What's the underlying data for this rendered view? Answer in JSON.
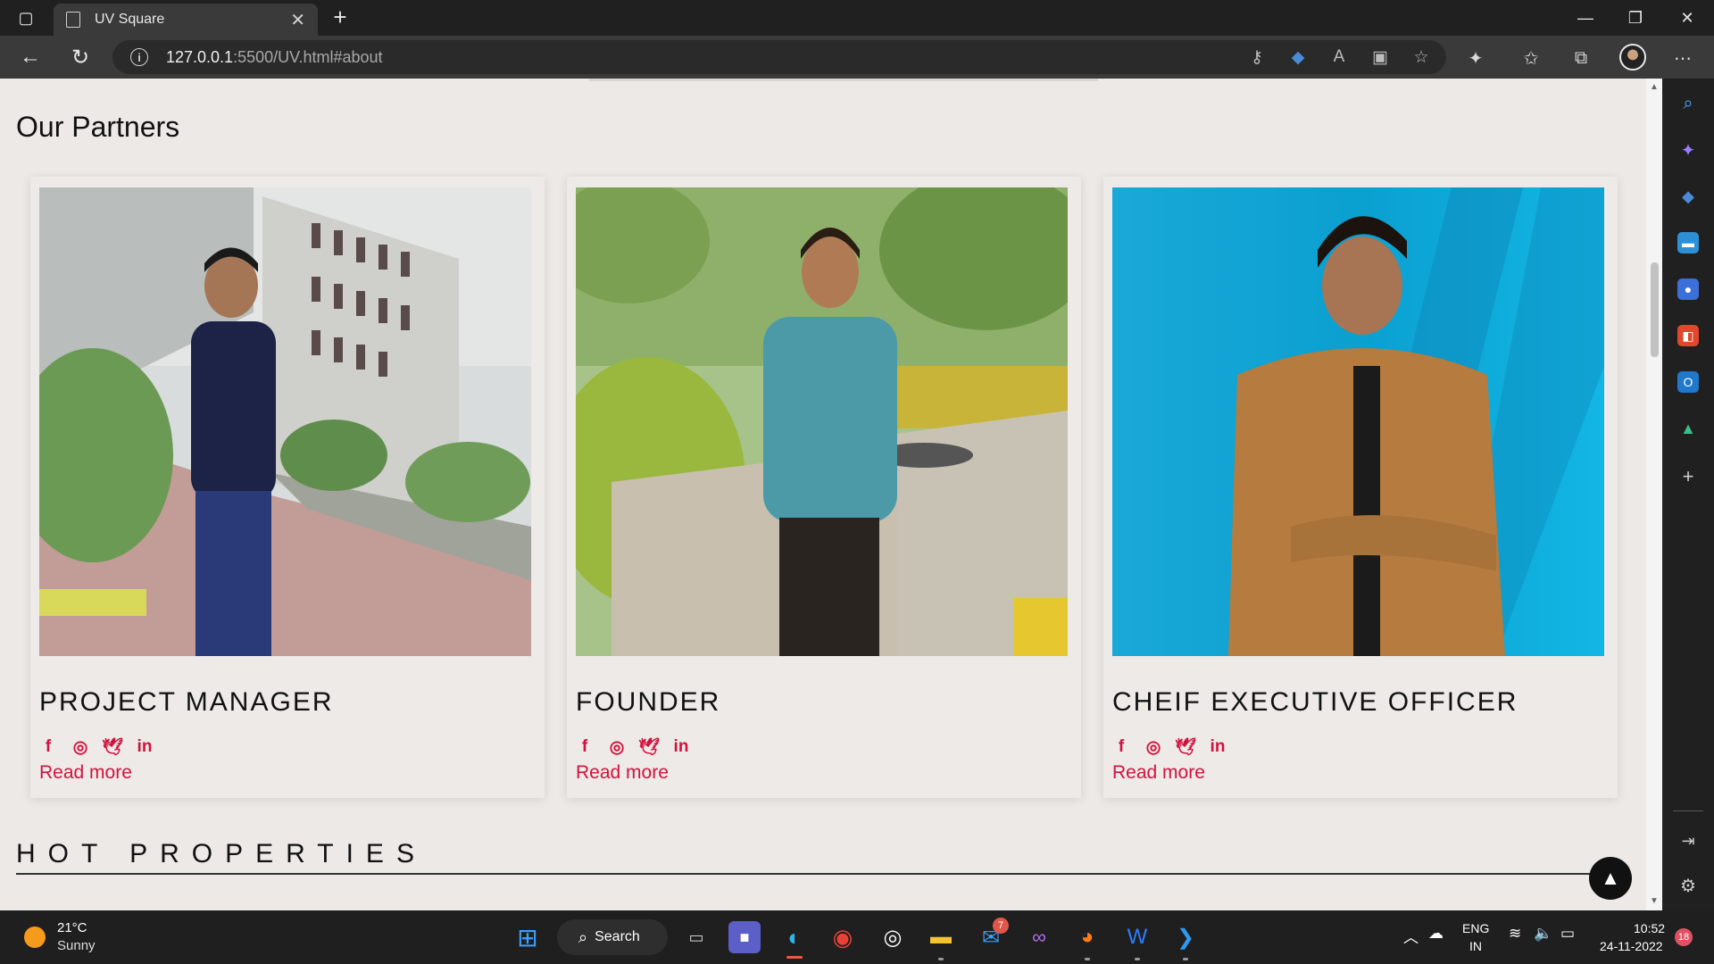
{
  "browser": {
    "tab_title": "UV Square",
    "tab_close": "✕",
    "new_tab": "+",
    "url_host": "127.0.0.1",
    "url_path": ":5500/UV.html#about"
  },
  "page": {
    "partners_heading": "Our Partners",
    "partners": [
      {
        "role": "PROJECT MANAGER",
        "read_more": "Read more"
      },
      {
        "role": "FOUNDER",
        "read_more": "Read more"
      },
      {
        "role": "CHEIF EXECUTIVE OFFICER",
        "read_more": "Read more"
      }
    ],
    "social_icons": [
      "facebook-icon",
      "instagram-icon",
      "twitter-icon",
      "linkedin-icon"
    ],
    "hot_heading": "HOT PROPERTIES"
  },
  "colors": {
    "accent": "#d3113d",
    "page_bg": "#ece9e6"
  },
  "taskbar": {
    "temperature": "21°C",
    "weather": "Sunny",
    "search_label": "Search",
    "mail_badge": "7",
    "lang_line1": "ENG",
    "lang_line2": "IN",
    "time": "10:52",
    "date": "24-11-2022",
    "notification_count": "18"
  }
}
